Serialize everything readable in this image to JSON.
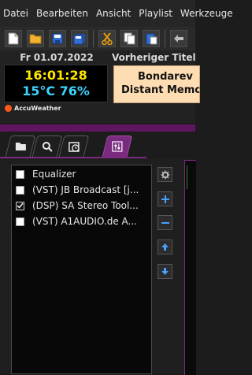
{
  "menu": [
    "Datei",
    "Bearbeiten",
    "Ansicht",
    "Playlist",
    "Werkzeuge"
  ],
  "toolbar": {
    "buttons": [
      "new-file-icon",
      "open-folder-icon",
      "save-icon",
      "save-all-icon",
      "cut-icon",
      "copy-icon",
      "paste-icon",
      "undo-icon"
    ]
  },
  "info": {
    "date": "Fr 01.07.2022",
    "clock": "16:01:28",
    "weather": "15°C 76%",
    "weather_provider": "AccuWeather",
    "previous_label": "Vorheriger Titel",
    "previous_artist": "Bondarev",
    "previous_title": "Distant Memories"
  },
  "tabs": [
    {
      "icon": "folder-icon",
      "active": false
    },
    {
      "icon": "search-icon",
      "active": false
    },
    {
      "icon": "schedule-icon",
      "active": false
    },
    {
      "icon": "equalizer-sliders-icon",
      "active": true
    }
  ],
  "plugins": {
    "items": [
      {
        "label": "Equalizer",
        "checked": false
      },
      {
        "label": "(VST) JB Broadcast [j...",
        "checked": false
      },
      {
        "label": "(DSP) SA Stereo Tool...",
        "checked": true
      },
      {
        "label": "(VST) A1AUDIO.de A...",
        "checked": false
      }
    ],
    "side_buttons": [
      "settings-gear-icon",
      "add-plus-icon",
      "remove-minus-icon",
      "move-up-icon",
      "move-down-icon"
    ]
  },
  "colors": {
    "accent_purple": "#7a2a7f",
    "clock_yellow": "#ffe600",
    "weather_cyan": "#3fd2ff",
    "previous_bg": "#ffddb3"
  }
}
